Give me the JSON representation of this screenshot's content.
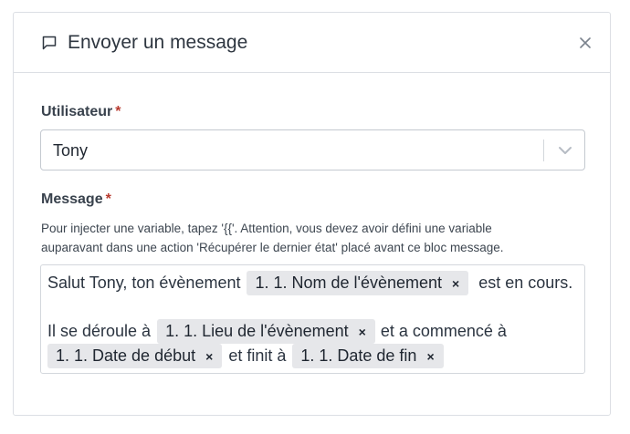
{
  "modal": {
    "title": "Envoyer un message",
    "header_icon": "message-square-icon",
    "close_icon": "close-icon"
  },
  "user_field": {
    "label": "Utilisateur",
    "required_mark": "*",
    "value": "Tony",
    "dropdown_icon": "chevron-down-icon"
  },
  "message_field": {
    "label": "Message",
    "required_mark": "*",
    "help_line1": "Pour injecter une variable, tapez '{{'. Attention, vous devez avoir défini une variable",
    "help_line2": "auparavant dans une action 'Récupérer le dernier état' placé avant ce bloc message.",
    "line1": {
      "text_before": "Salut Tony, ton évènement",
      "chip": "1. 1. Nom de l'évènement",
      "text_after": "est en cours."
    },
    "line2": {
      "text_before": "Il se déroule à",
      "chip": "1. 1. Lieu de l'évènement",
      "text_after": "et a commencé à"
    },
    "line3": {
      "chip1": "1. 1. Date de début",
      "text_mid": "et finit à",
      "chip2": "1. 1. Date de fin"
    },
    "chip_remove": "×"
  },
  "colors": {
    "required": "#b83a2f",
    "chip_bg": "#e6e7ea",
    "border": "#dcdfe4"
  }
}
